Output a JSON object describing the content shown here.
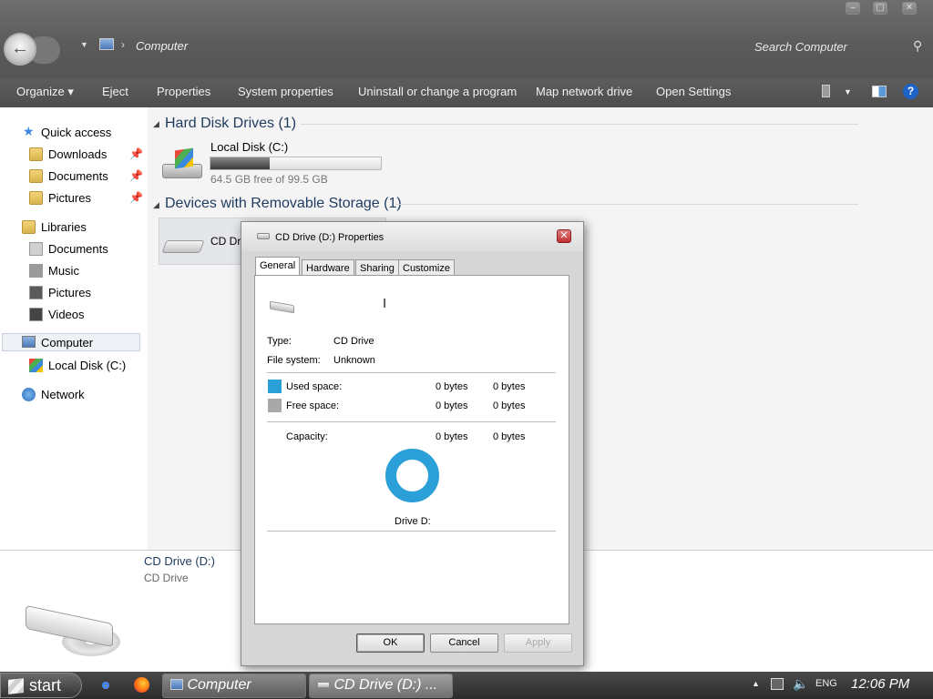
{
  "window": {
    "breadcrumb": "Computer",
    "search_placeholder": "Search Computer"
  },
  "toolbar": {
    "organize": "Organize ▾",
    "eject": "Eject",
    "properties": "Properties",
    "system_properties": "System properties",
    "uninstall": "Uninstall or change a program",
    "map_drive": "Map network drive",
    "open_settings": "Open Settings"
  },
  "nav": {
    "quick_access": "Quick access",
    "downloads": "Downloads",
    "documents": "Documents",
    "pictures": "Pictures",
    "libraries": "Libraries",
    "lib_documents": "Documents",
    "music": "Music",
    "lib_pictures": "Pictures",
    "videos": "Videos",
    "computer": "Computer",
    "local_disk": "Local Disk (C:)",
    "network": "Network"
  },
  "content": {
    "hdd_group": "Hard Disk Drives (1)",
    "local_disk_name": "Local Disk (C:)",
    "local_disk_free": "64.5 GB free of 99.5 GB",
    "local_disk_used_fraction": 0.35,
    "removable_group": "Devices with Removable Storage (1)",
    "cd_item_label": "CD Dr"
  },
  "details": {
    "name": "CD Drive (D:)",
    "type": "CD Drive"
  },
  "dialog": {
    "title": "CD Drive (D:) Properties",
    "tabs": {
      "general": "General",
      "hardware": "Hardware",
      "sharing": "Sharing",
      "customize": "Customize"
    },
    "type_label": "Type:",
    "type_value": "CD Drive",
    "fs_label": "File system:",
    "fs_value": "Unknown",
    "used_label": "Used space:",
    "used_bytes": "0 bytes",
    "used_bytes2": "0 bytes",
    "free_label": "Free space:",
    "free_bytes": "0 bytes",
    "free_bytes2": "0 bytes",
    "capacity_label": "Capacity:",
    "capacity_bytes": "0 bytes",
    "capacity_bytes2": "0 bytes",
    "drive_label": "Drive D:",
    "ok": "OK",
    "cancel": "Cancel",
    "apply": "Apply"
  },
  "colors": {
    "used": "#2a9fd8",
    "free": "#a8a8a8"
  },
  "taskbar": {
    "start": "start",
    "task_computer": "Computer",
    "task_cd": "CD Drive (D:) ...",
    "lang": "ENG",
    "time": "12:06 PM"
  }
}
